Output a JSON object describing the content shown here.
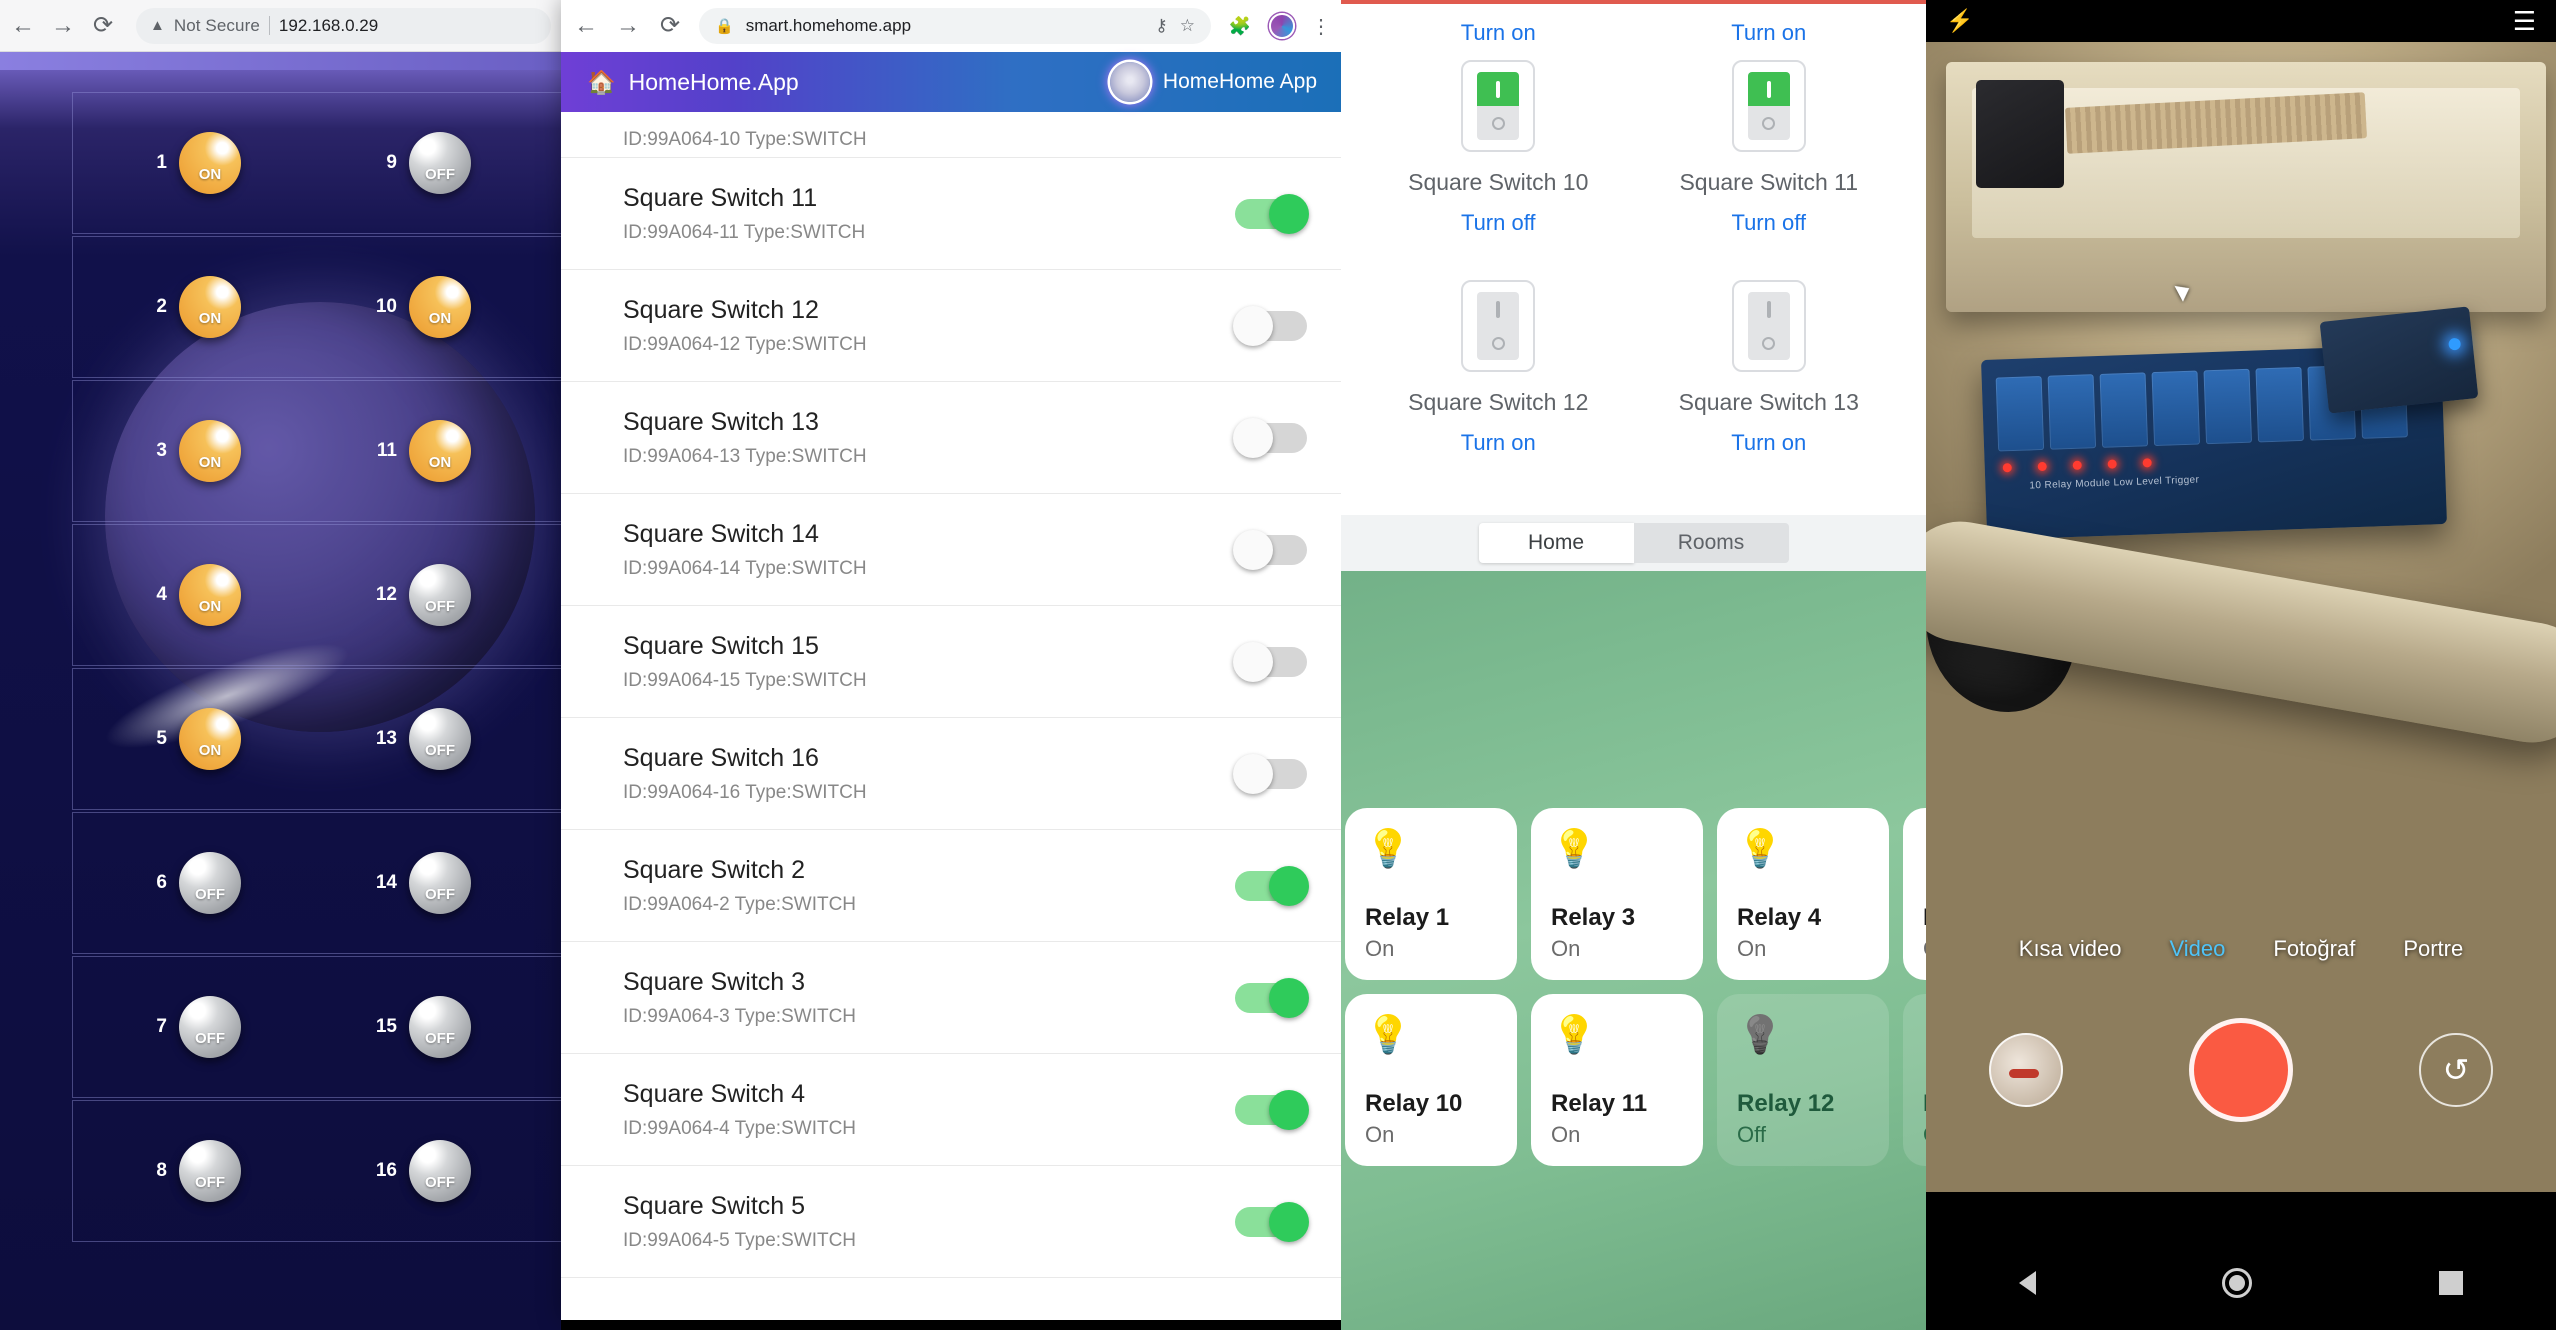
{
  "window1": {
    "browser": {
      "back_icon": "arrow-left-icon",
      "forward_icon": "arrow-right-icon",
      "reload_icon": "reload-icon",
      "security_icon": "warning-triangle-icon",
      "security_label": "Not Secure",
      "url": "192.168.0.29"
    },
    "relays": [
      {
        "num": "1",
        "state": "ON",
        "num2": "9",
        "state2": "OFF"
      },
      {
        "num": "2",
        "state": "ON",
        "num2": "10",
        "state2": "ON"
      },
      {
        "num": "3",
        "state": "ON",
        "num2": "11",
        "state2": "ON"
      },
      {
        "num": "4",
        "state": "ON",
        "num2": "12",
        "state2": "OFF"
      },
      {
        "num": "5",
        "state": "ON",
        "num2": "13",
        "state2": "OFF"
      },
      {
        "num": "6",
        "state": "OFF",
        "num2": "14",
        "state2": "OFF"
      },
      {
        "num": "7",
        "state": "OFF",
        "num2": "15",
        "state2": "OFF"
      },
      {
        "num": "8",
        "state": "OFF",
        "num2": "16",
        "state2": "OFF"
      }
    ]
  },
  "window2": {
    "browser": {
      "back_icon": "arrow-left-icon",
      "forward_icon": "arrow-right-icon",
      "reload_icon": "reload-icon",
      "lock_icon": "lock-icon",
      "url": "smart.homehome.app",
      "key_icon": "key-icon",
      "star_icon": "star-icon",
      "extension_icon": "puzzle-piece-icon",
      "profile_icon": "profile-avatar-icon",
      "menu_icon": "kebab-menu-icon"
    },
    "appbar": {
      "home_icon": "home-icon",
      "brand": "HomeHome.App",
      "account_name": "HomeHome App",
      "avatar_icon": "user-avatar-icon"
    },
    "switches": [
      {
        "name": "",
        "id": "ID:99A064-10 Type:SWITCH",
        "state": "on",
        "partial": true
      },
      {
        "name": "Square Switch 11",
        "id": "ID:99A064-11 Type:SWITCH",
        "state": "on",
        "partial": false
      },
      {
        "name": "Square Switch 12",
        "id": "ID:99A064-12 Type:SWITCH",
        "state": "off",
        "partial": false
      },
      {
        "name": "Square Switch 13",
        "id": "ID:99A064-13 Type:SWITCH",
        "state": "off",
        "partial": false
      },
      {
        "name": "Square Switch 14",
        "id": "ID:99A064-14 Type:SWITCH",
        "state": "off",
        "partial": false
      },
      {
        "name": "Square Switch 15",
        "id": "ID:99A064-15 Type:SWITCH",
        "state": "off",
        "partial": false
      },
      {
        "name": "Square Switch 16",
        "id": "ID:99A064-16 Type:SWITCH",
        "state": "off",
        "partial": false
      },
      {
        "name": "Square Switch 2",
        "id": "ID:99A064-2 Type:SWITCH",
        "state": "on",
        "partial": false
      },
      {
        "name": "Square Switch 3",
        "id": "ID:99A064-3 Type:SWITCH",
        "state": "on",
        "partial": false
      },
      {
        "name": "Square Switch 4",
        "id": "ID:99A064-4 Type:SWITCH",
        "state": "on",
        "partial": false
      },
      {
        "name": "Square Switch 5",
        "id": "ID:99A064-5 Type:SWITCH",
        "state": "on",
        "partial": false
      }
    ]
  },
  "window3": {
    "assistant_cards": [
      {
        "top_action": "Turn on",
        "name": "Square Switch 10",
        "bottom_action": "Turn off",
        "state": "on"
      },
      {
        "top_action": "Turn on",
        "name": "Square Switch 11",
        "bottom_action": "Turn off",
        "state": "on"
      },
      {
        "top_action": "",
        "name": "Square Switch 12",
        "bottom_action": "Turn on",
        "state": "off"
      },
      {
        "top_action": "",
        "name": "Square Switch 13",
        "bottom_action": "Turn on",
        "state": "off"
      }
    ],
    "tabs": [
      {
        "label": "Home",
        "active": true
      },
      {
        "label": "Rooms",
        "active": false
      }
    ],
    "relay_tiles": [
      {
        "name": "Relay 1",
        "state": "On",
        "on": true
      },
      {
        "name": "Relay 3",
        "state": "On",
        "on": true
      },
      {
        "name": "Relay 4",
        "state": "On",
        "on": true
      },
      {
        "name": "Relay",
        "state": "On",
        "on": true
      },
      {
        "name": "Relay 10",
        "state": "On",
        "on": true
      },
      {
        "name": "Relay 11",
        "state": "On",
        "on": true
      },
      {
        "name": "Relay 12",
        "state": "Off",
        "on": false
      },
      {
        "name": "Relay",
        "state": "Off",
        "on": false
      }
    ],
    "bulb_icon": "light-bulb-icon"
  },
  "window4": {
    "status": {
      "flash_icon": "flash-off-icon",
      "menu_icon": "hamburger-menu-icon"
    },
    "modes": [
      {
        "label": "Kısa video",
        "active": false
      },
      {
        "label": "Video",
        "active": true
      },
      {
        "label": "Fotoğraf",
        "active": false
      },
      {
        "label": "Portre",
        "active": false
      }
    ],
    "controls": {
      "gallery_icon": "gallery-thumbnail-icon",
      "shutter_icon": "record-button-icon",
      "flip_icon": "flip-camera-icon"
    },
    "navbar": {
      "back_icon": "triangle-back-icon",
      "home_icon": "circle-home-icon",
      "recents_icon": "square-recents-icon"
    },
    "device_label": "10 Relay Module  Low Level Trigger"
  }
}
